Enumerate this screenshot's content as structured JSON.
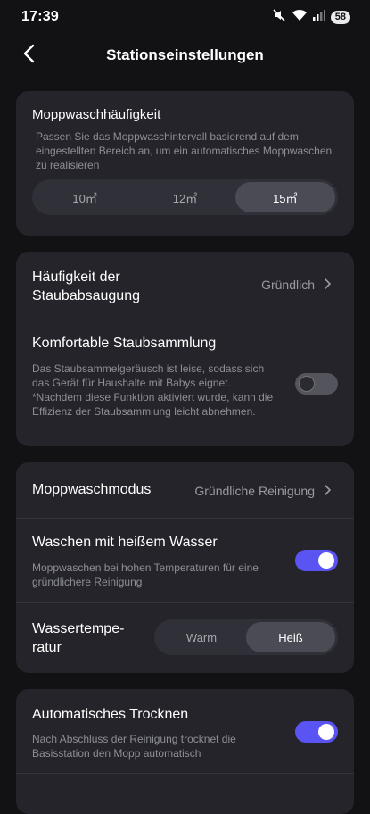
{
  "status_bar": {
    "time": "17:39",
    "battery": "58"
  },
  "header": {
    "title": "Stationseinstellungen"
  },
  "mop_wash_frequency": {
    "title": "Moppwaschhäufigkeit",
    "description": "Passen Sie das Moppwaschintervall basierend auf dem eingestellten Bereich an, um ein automatisches Moppwaschen zu realisieren",
    "options": [
      "10㎡",
      "12㎡",
      "15㎡"
    ],
    "selected": "15㎡"
  },
  "dust_collection": {
    "frequency_title": "Häufigkeit der Staubabsaugung",
    "frequency_value": "Gründlich",
    "comfort_title": "Komfortable Staubsammlung",
    "comfort_description": "Das Staubsammelgeräusch ist leise, sodass sich das Gerät für Haushalte mit Babys eignet. *Nachdem diese Funktion aktiviert wurde, kann die Effizienz der Staubsammlung leicht abnehmen.",
    "comfort_enabled": false
  },
  "mop_wash": {
    "mode_title": "Moppwaschmodus",
    "mode_value": "Gründliche Reinigung",
    "hot_water_title": "Waschen mit heißem Wasser",
    "hot_water_description": "Moppwaschen bei hohen Temperaturen für eine gründlichere Reinigung",
    "hot_water_enabled": true,
    "temperature_title": "Wassertempe-ratur",
    "temperature_options": [
      "Warm",
      "Heiß"
    ],
    "temperature_selected": "Heiß"
  },
  "drying": {
    "title": "Automatisches Trocknen",
    "description": "Nach Abschluss der Reinigung trocknet die Basisstation den Mopp automatisch",
    "enabled": true
  },
  "colors": {
    "accent": "#5a54f2",
    "card": "#24242a",
    "background": "#121215"
  }
}
